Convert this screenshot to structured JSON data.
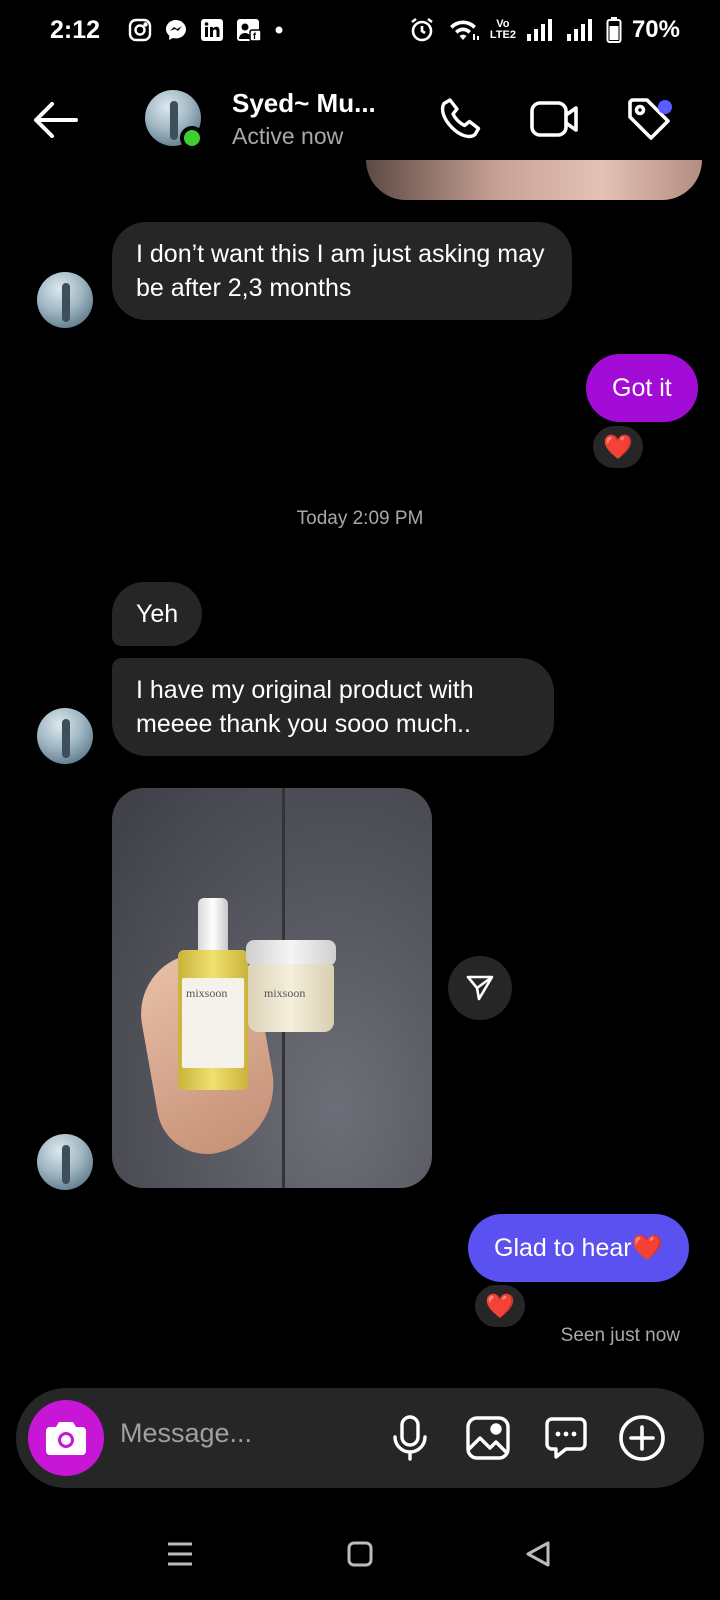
{
  "status_bar": {
    "time": "2:12",
    "battery": "70%",
    "network_label_top": "Vo",
    "network_label_bottom": "LTE2",
    "icons_left": [
      "instagram-icon",
      "messenger-icon",
      "linkedin-icon",
      "facebook-ads-icon",
      "dot-icon"
    ],
    "icons_right": [
      "alarm-icon",
      "wifi-icon",
      "volte-icon",
      "signal-icon",
      "signal-icon",
      "battery-icon"
    ]
  },
  "header": {
    "contact_name": "Syed~ Mu...",
    "status": "Active now",
    "online_color": "#3cd12f",
    "notification_dot_color": "#5a5cff"
  },
  "timestamp": "Today 2:09 PM",
  "messages": [
    {
      "from": "them",
      "text": "I don’t want this I am just asking may be after 2,3 months"
    },
    {
      "from": "me",
      "text": "Got it",
      "reaction": "❤️",
      "color": "#a30bd6"
    },
    {
      "from": "them",
      "text": "Yeh"
    },
    {
      "from": "them",
      "text": "I have my original product with meeee thank you sooo much.."
    },
    {
      "from": "them",
      "type": "photo",
      "brand_bottle": "mixsoon",
      "brand_jar": "mixsoon"
    },
    {
      "from": "me",
      "text": "Glad to hear❤️",
      "reaction": "❤️",
      "color": "#5b50f0"
    }
  ],
  "seen_status": "Seen just now",
  "composer": {
    "placeholder": "Message...",
    "camera_color": "#c816d6"
  },
  "colors": {
    "background": "#000000",
    "incoming_bubble": "#262626",
    "secondary_text": "#a8a8a8"
  }
}
